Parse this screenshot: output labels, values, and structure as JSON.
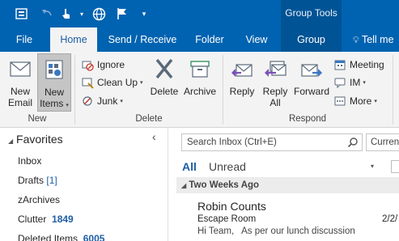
{
  "context_tab": "Group Tools",
  "tabs": [
    "File",
    "Home",
    "Send / Receive",
    "Folder",
    "View",
    "Group",
    "Tell me"
  ],
  "ribbon": {
    "new_email": "New\nEmail",
    "new_items": "New\nItems",
    "group_new": "New",
    "ignore": "Ignore",
    "clean_up": "Clean Up",
    "junk": "Junk",
    "delete": "Delete",
    "archive": "Archive",
    "group_delete": "Delete",
    "reply": "Reply",
    "reply_all": "Reply\nAll",
    "forward": "Forward",
    "meeting": "Meeting",
    "im": "IM",
    "more": "More",
    "group_respond": "Respond"
  },
  "folders": {
    "header": "Favorites",
    "items": [
      {
        "name": "Inbox",
        "count": ""
      },
      {
        "name": "Drafts",
        "count": "[1]"
      },
      {
        "name": "zArchives",
        "count": ""
      },
      {
        "name": "Clutter",
        "count": "1849"
      },
      {
        "name": "Deleted Items",
        "count": "6005"
      }
    ]
  },
  "messages": {
    "search_placeholder": "Search Inbox (Ctrl+E)",
    "scope": "Curren",
    "filter_all": "All",
    "filter_unread": "Unread",
    "group_header": "Two Weeks Ago",
    "items": [
      {
        "sender": "Robin Counts",
        "subject": "Escape Room",
        "preview": "Hi Team,   As per our lunch discussion",
        "date": "2/2/"
      }
    ]
  },
  "colors": {
    "title_blue": "#0063b1",
    "context_blue": "#005395",
    "ribbon_bg": "#f3f3f3",
    "accent": "#1e5ea6"
  }
}
